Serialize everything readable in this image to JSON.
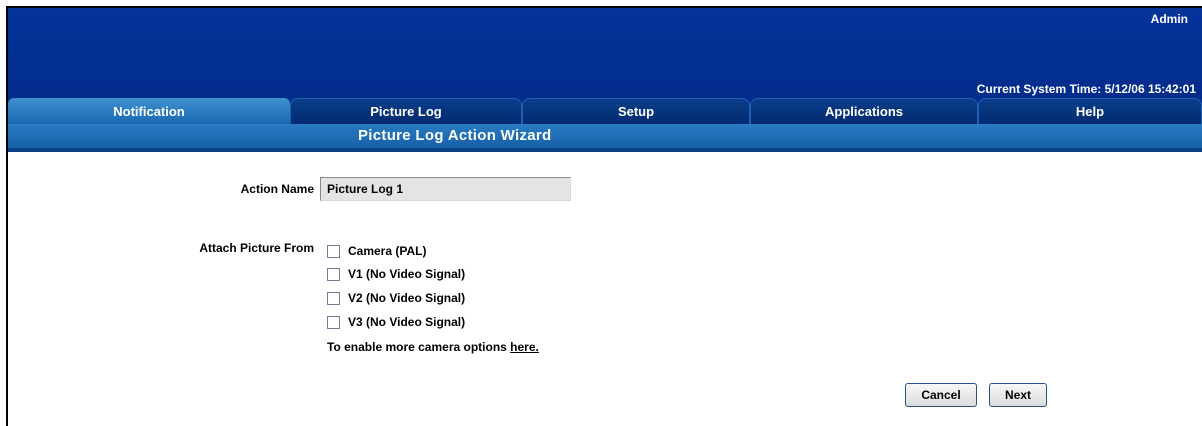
{
  "header": {
    "user": "Admin",
    "system_time": "Current System Time: 5/12/06 15:42:01"
  },
  "tabs": [
    {
      "label": "Notification",
      "active": true
    },
    {
      "label": "Picture Log",
      "active": false
    },
    {
      "label": "Setup",
      "active": false
    },
    {
      "label": "Applications",
      "active": false
    },
    {
      "label": "Help",
      "active": false
    }
  ],
  "wizard": {
    "title": "Picture Log Action Wizard"
  },
  "form": {
    "action_name_label": "Action Name",
    "action_name_value": "Picture Log 1",
    "attach_label": "Attach Picture From",
    "sources": [
      {
        "label": "Camera (PAL)",
        "checked": false
      },
      {
        "label": "V1 (No Video Signal)",
        "checked": false
      },
      {
        "label": "V2 (No Video Signal)",
        "checked": false
      },
      {
        "label": "V3 (No Video Signal)",
        "checked": false
      }
    ],
    "enable_text": "To enable more camera options ",
    "enable_link": "here."
  },
  "buttons": {
    "cancel": "Cancel",
    "next": "Next"
  },
  "colors": {
    "header_bg": "#022f91",
    "active_tab": "#2a7cc4",
    "wizard_bar": "#1c6cb4"
  }
}
